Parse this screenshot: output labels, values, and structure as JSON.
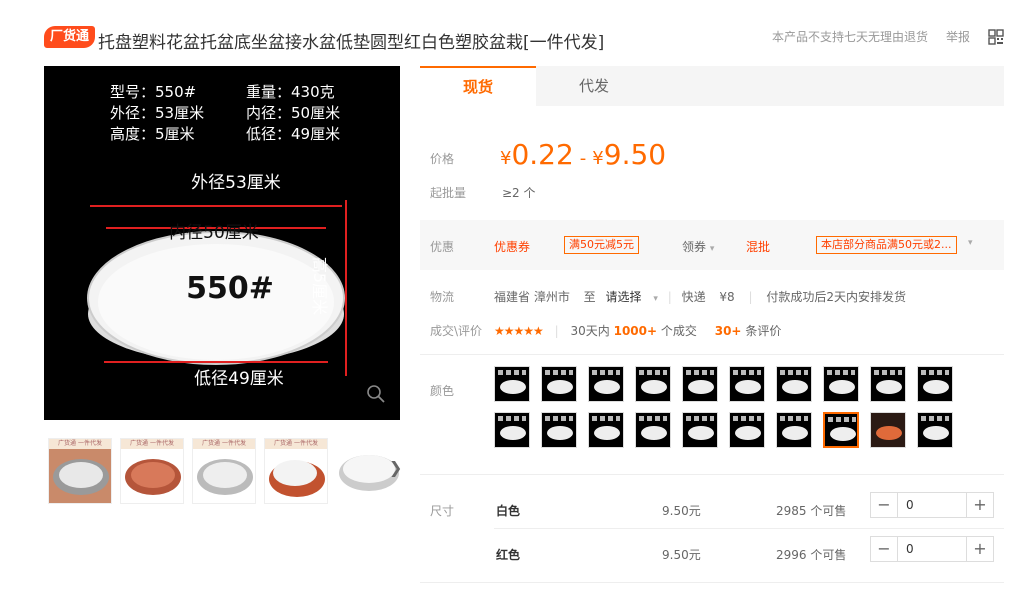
{
  "header": {
    "badge": "厂货通",
    "title": "托盘塑料花盆托盆底坐盆接水盆低垫圆型红白色塑胶盆栽[一件代发]",
    "no_return_notice": "本产品不支持七天无理由退货",
    "report_link": "举报",
    "qr_icon": "qr-code-icon"
  },
  "product_image": {
    "spec_left": [
      "型号：550#",
      "外径：53厘米",
      "高度：5厘米"
    ],
    "spec_right": [
      "重量：430克",
      "内径：50厘米",
      "低径：49厘米"
    ],
    "outer_label": "外径53厘米",
    "inner_label": "内径50厘米",
    "model_label": "550#",
    "height_label": "高5厘米",
    "bottom_label": "低径49厘米",
    "thumb_caption": "广货通 一件代发",
    "zoom_icon": "magnifier-icon"
  },
  "tabs": [
    "现货",
    "代发"
  ],
  "pricing": {
    "price_label": "价格",
    "currency": "¥",
    "price_min": "0.22",
    "price_sep": "-",
    "price_max": "9.50",
    "moq_label": "起批量",
    "moq_value": "≥2 个"
  },
  "promo": {
    "label": "优惠",
    "coupon_title": "优惠券",
    "coupon_tag": "满50元减5元",
    "get_coupon": "领券",
    "mix_title": "混批",
    "mix_tag": "本店部分商品满50元或2..."
  },
  "logistics": {
    "label": "物流",
    "origin": "福建省 漳州市",
    "to": "至",
    "dest": "请选择",
    "express": "快递",
    "fee": "¥8",
    "ship_note": "付款成功后2天内安排发货"
  },
  "reviews": {
    "label": "成交\\评价",
    "stars": "★★★★★",
    "period": "30天内",
    "deals": "1000+",
    "deals_unit": "个成交",
    "review_count": "30+",
    "review_unit": "条评价"
  },
  "colors": {
    "label": "颜色",
    "swatch_count": 20,
    "selected_index": 17,
    "red_index": 18
  },
  "sizes": {
    "label": "尺寸",
    "rows": [
      {
        "name": "白色",
        "price": "9.50元",
        "stock": "2985 个可售",
        "qty": "0"
      },
      {
        "name": "红色",
        "price": "9.50元",
        "stock": "2996 个可售",
        "qty": "0"
      }
    ]
  },
  "colors_theme": {
    "accent": "#ff6a00",
    "badge": "#ff4c1c"
  }
}
